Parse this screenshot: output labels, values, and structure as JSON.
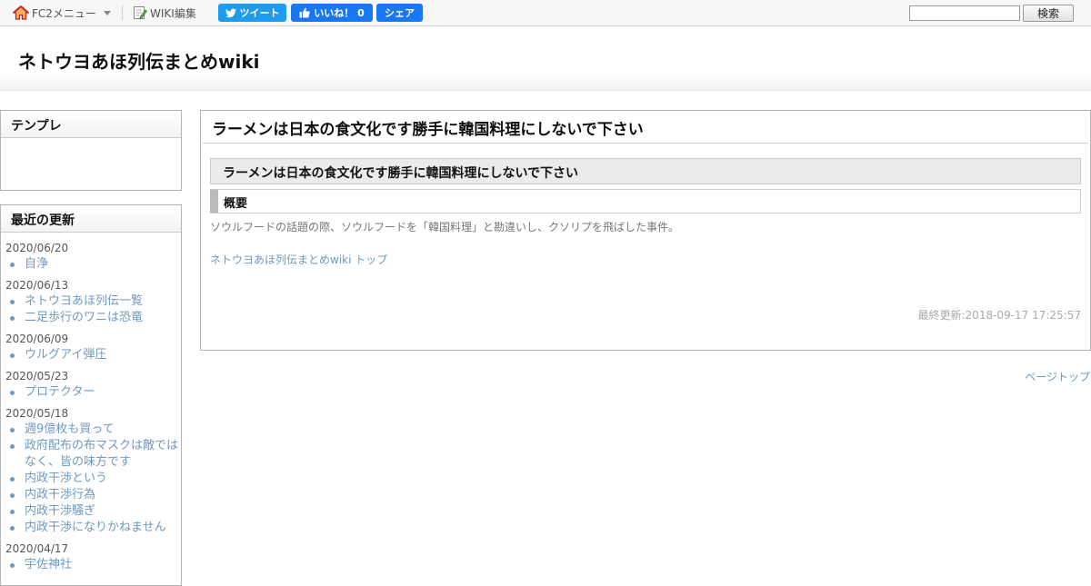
{
  "topbar": {
    "fc2_menu": "FC2メニュー",
    "wiki_edit": "WIKI編集",
    "tweet": "ツイート",
    "like": "いいね！ 0",
    "share": "シェア",
    "search_value": "",
    "search_button": "検索"
  },
  "site_title": "ネトウヨあほ列伝まとめwiki",
  "sidebar": {
    "template_title": "テンプレ",
    "recent_title": "最近の更新",
    "groups": [
      {
        "date": "2020/06/20",
        "items": [
          "自浄"
        ]
      },
      {
        "date": "2020/06/13",
        "items": [
          "ネトウヨあほ列伝一覧",
          "二足歩行のワニは恐竜"
        ]
      },
      {
        "date": "2020/06/09",
        "items": [
          "ウルグアイ弾圧"
        ]
      },
      {
        "date": "2020/05/23",
        "items": [
          "プロテクター"
        ]
      },
      {
        "date": "2020/05/18",
        "items": [
          "週9億枚も買って",
          "政府配布の布マスクは敵ではなく、皆の味方です",
          "内政干渉という",
          "内政干渉行為",
          "内政干渉騒ぎ",
          "内政干渉になりかねません"
        ]
      },
      {
        "date": "2020/04/17",
        "items": [
          "宇佐神社"
        ]
      }
    ]
  },
  "main": {
    "page_title": "ラーメンは日本の食文化です勝手に韓国料理にしないで下さい",
    "heading": "ラーメンは日本の食文化です勝手に韓国料理にしないで下さい",
    "section": "概要",
    "summary": "ソウルフードの話題の際、ソウルフードを「韓国料理」と勘違いし、クソリプを飛ばした事件。",
    "top_link": "ネトウヨあほ列伝まとめwiki トップ",
    "last_updated": "最終更新:2018-09-17 17:25:57",
    "page_top": "ページトップ"
  },
  "colors": {
    "link": "#6f99c0",
    "tweet": "#1d9bf0",
    "facebook": "#1877f2"
  },
  "icons": [
    "home-icon",
    "edit-icon",
    "twitter-bird-icon",
    "thumbs-up-icon",
    "chevron-down-icon"
  ]
}
